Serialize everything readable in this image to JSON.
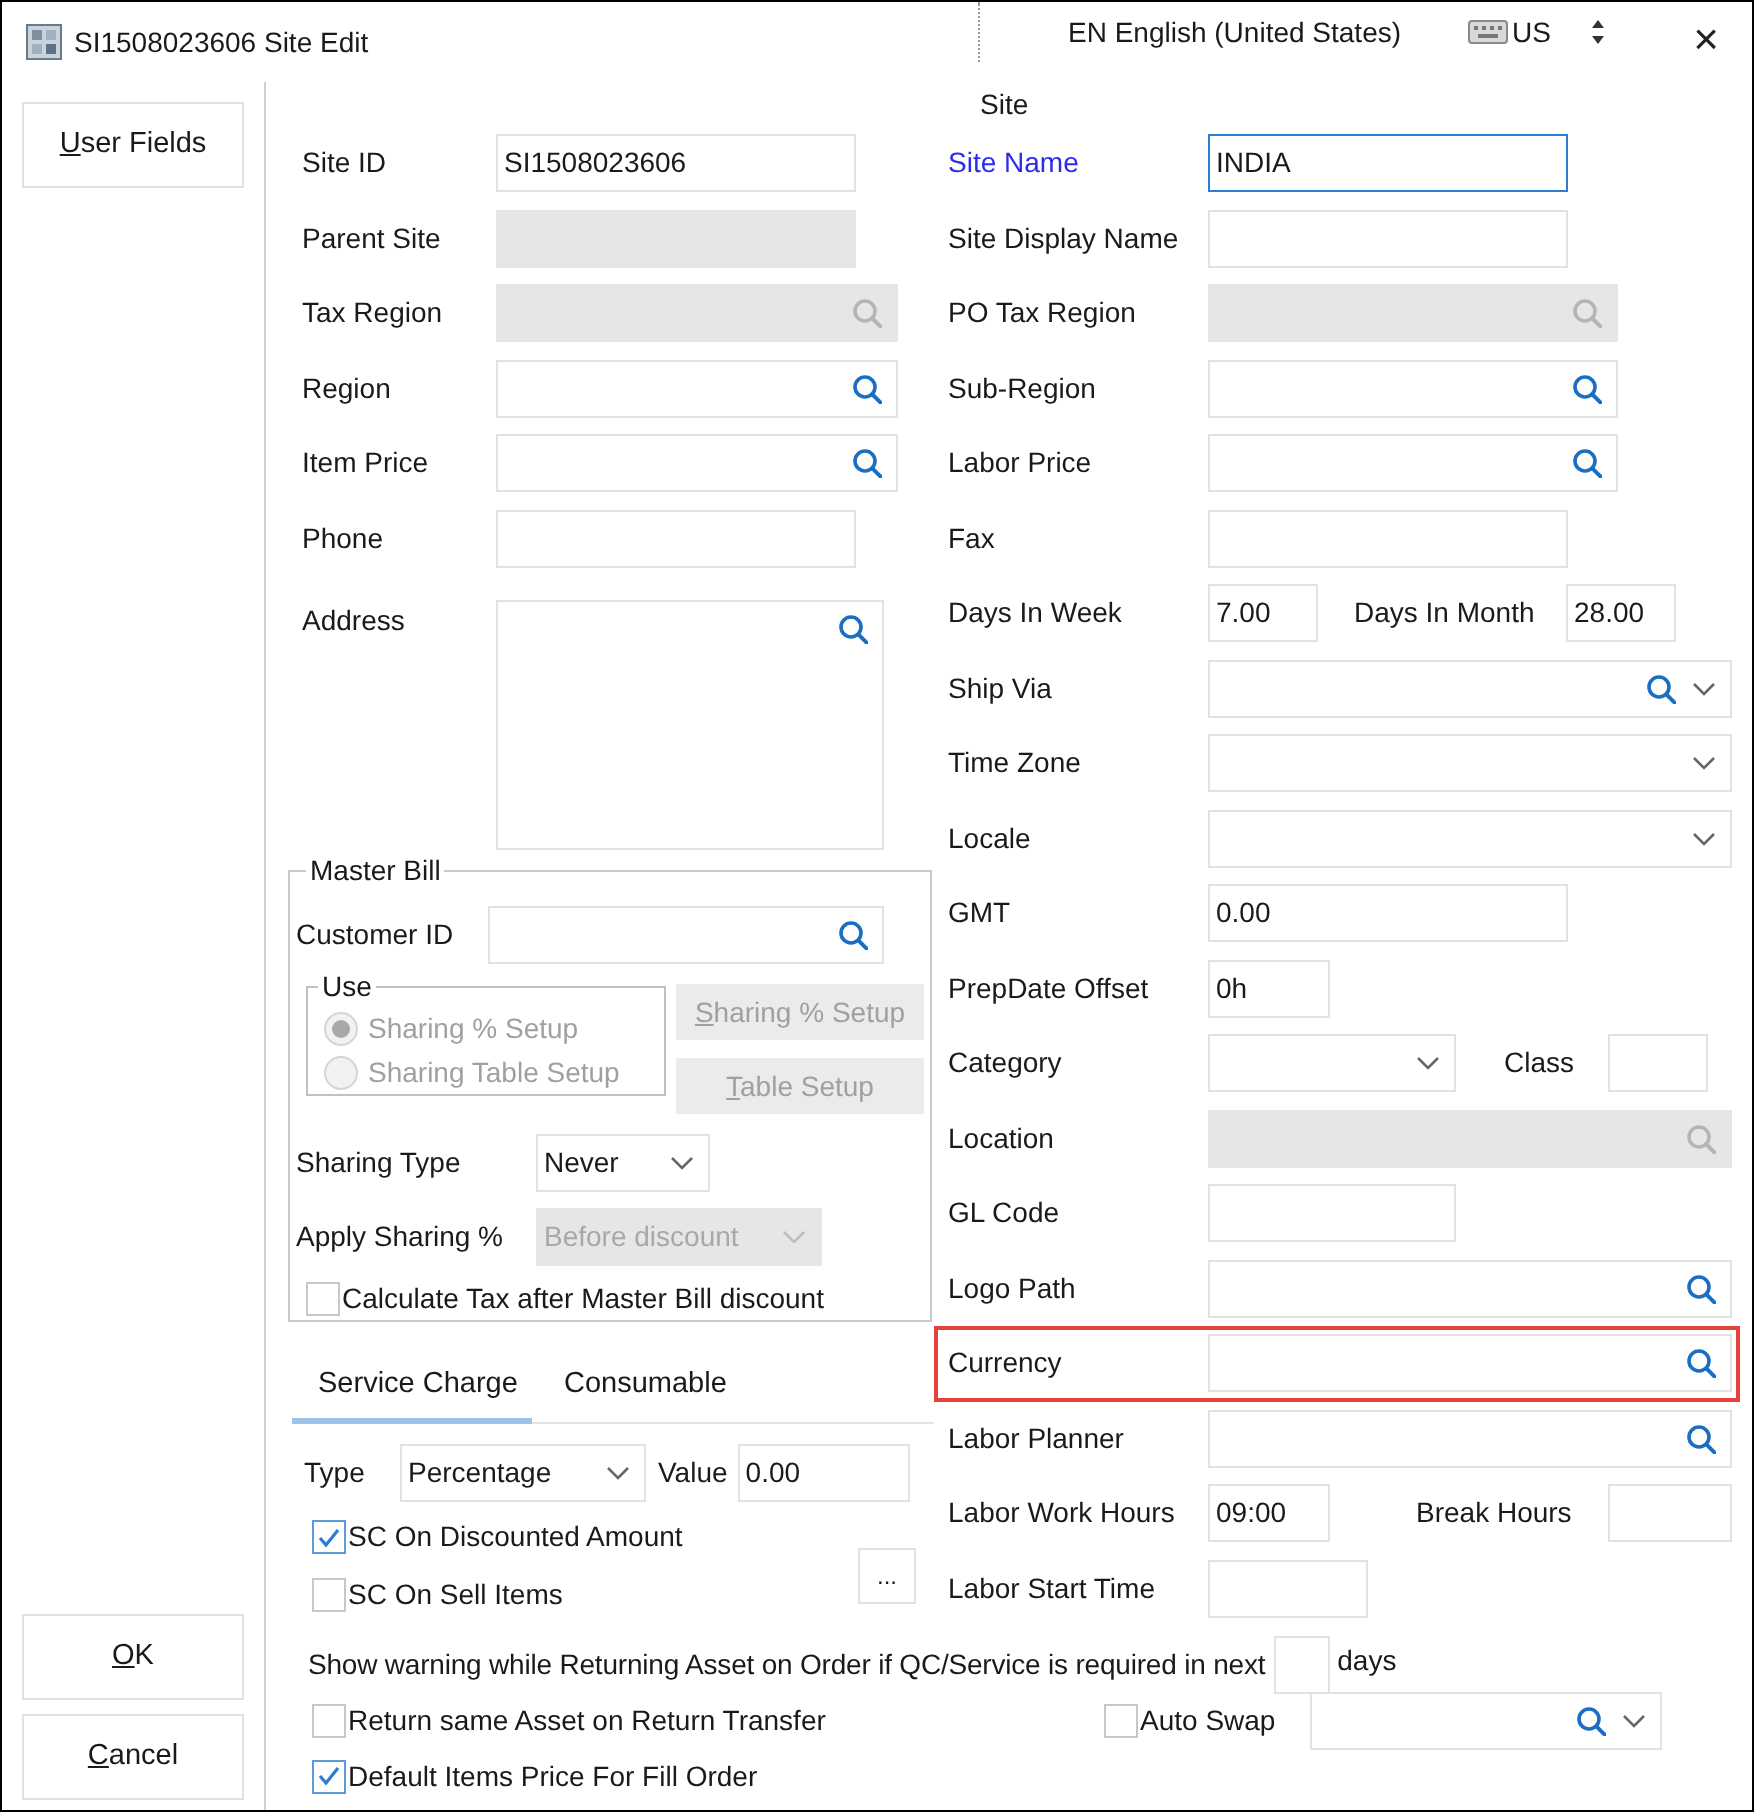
{
  "window": {
    "title": "SI1508023606 Site Edit",
    "close": "×"
  },
  "language_bar": {
    "language": "EN English (United States)",
    "layout": "US"
  },
  "sidebar": {
    "buttons": [
      {
        "label": "User Fields"
      }
    ],
    "footer_buttons": [
      {
        "label": "OK"
      },
      {
        "label": "Cancel"
      }
    ]
  },
  "section_title": "Site",
  "left_fields": [
    {
      "label": "Site ID",
      "kind": "text",
      "value": "SI1508023606",
      "disabled": false
    },
    {
      "label": "Parent Site",
      "kind": "text",
      "disabled": true
    },
    {
      "label": "Tax Region",
      "kind": "search",
      "disabled": true
    },
    {
      "label": "Region",
      "kind": "search",
      "disabled": false
    },
    {
      "label": "Item Price",
      "kind": "search",
      "disabled": false
    },
    {
      "label": "Phone",
      "kind": "text",
      "disabled": false
    },
    {
      "label": "Address",
      "kind": "textarea",
      "disabled": false
    }
  ],
  "right_fields": [
    {
      "label": "Site Name",
      "kind": "text",
      "value": "INDIA",
      "required": true,
      "focused": true,
      "disabled": false,
      "highlighted": false
    },
    {
      "label": "Site Display Name",
      "kind": "text",
      "required": false,
      "focused": false,
      "disabled": false,
      "highlighted": false
    },
    {
      "label": "PO Tax Region",
      "kind": "search",
      "required": false,
      "focused": false,
      "disabled": true,
      "highlighted": false
    },
    {
      "label": "Sub-Region",
      "kind": "search",
      "required": false,
      "focused": false,
      "disabled": false,
      "highlighted": false
    },
    {
      "label": "Labor Price",
      "kind": "search",
      "required": false,
      "focused": false,
      "disabled": false,
      "highlighted": false
    },
    {
      "label": "Fax",
      "kind": "text",
      "required": false,
      "focused": false,
      "disabled": false,
      "highlighted": false
    },
    {
      "label": "Days In Week",
      "kind": "pair",
      "value": "7.00",
      "second_label": "Days In Month",
      "second_value": "28.00",
      "required": false,
      "focused": false,
      "disabled": false,
      "highlighted": false
    },
    {
      "label": "Ship Via",
      "kind": "search_select",
      "required": false,
      "focused": false,
      "disabled": false,
      "highlighted": false
    },
    {
      "label": "Time Zone",
      "kind": "select",
      "required": false,
      "focused": false,
      "disabled": false,
      "highlighted": false
    },
    {
      "label": "Locale",
      "kind": "select",
      "required": false,
      "focused": false,
      "disabled": false,
      "highlighted": false
    },
    {
      "label": "GMT",
      "kind": "text",
      "value": "0.00",
      "required": false,
      "focused": false,
      "disabled": false,
      "highlighted": false
    },
    {
      "label": "PrepDate Offset",
      "kind": "text",
      "value": "0h",
      "required": false,
      "focused": false,
      "disabled": false,
      "highlighted": false
    },
    {
      "label": "Category",
      "kind": "select_pair",
      "second_label": "Class",
      "required": false,
      "focused": false,
      "disabled": false,
      "highlighted": false
    },
    {
      "label": "Location",
      "kind": "search",
      "required": false,
      "focused": false,
      "disabled": true,
      "highlighted": false
    },
    {
      "label": "GL Code",
      "kind": "text",
      "required": false,
      "focused": false,
      "disabled": false,
      "highlighted": false
    },
    {
      "label": "Logo Path",
      "kind": "search",
      "required": false,
      "focused": false,
      "disabled": false,
      "highlighted": false
    },
    {
      "label": "Currency",
      "kind": "search",
      "required": false,
      "focused": false,
      "disabled": false,
      "highlighted": true
    },
    {
      "label": "Labor Planner",
      "kind": "search",
      "required": false,
      "focused": false,
      "disabled": false,
      "highlighted": false
    },
    {
      "label": "Labor Work Hours",
      "kind": "pair",
      "value": "09:00",
      "second_label": "Break Hours",
      "required": false,
      "focused": false,
      "disabled": false,
      "highlighted": false
    },
    {
      "label": "Labor Start Time",
      "kind": "text",
      "required": false,
      "focused": false,
      "disabled": false,
      "highlighted": false
    }
  ],
  "master_bill": {
    "title": "Master Bill",
    "customer_label": "Customer ID",
    "use_group": {
      "title": "Use",
      "options": [
        {
          "label": "Sharing % Setup",
          "selected": true,
          "disabled": true
        },
        {
          "label": "Sharing Table Setup",
          "selected": false,
          "disabled": true
        }
      ]
    },
    "buttons": [
      {
        "label": "Sharing % Setup",
        "disabled": true
      },
      {
        "label": "Table Setup",
        "disabled": true
      }
    ],
    "sharing_type": {
      "label": "Sharing Type",
      "value": "Never",
      "disabled": false
    },
    "apply_sharing": {
      "label": "Apply Sharing %",
      "value": "Before discount",
      "disabled": true
    },
    "calc_tax": {
      "label": "Calculate Tax after Master Bill discount",
      "checked": false
    }
  },
  "tabs": [
    {
      "label": "Service Charge",
      "selected": true
    },
    {
      "label": "Consumable",
      "selected": false
    }
  ],
  "service_charge": {
    "type_label": "Type",
    "type_value": "Percentage",
    "value_label": "Value",
    "value": "0.00",
    "checkboxes": [
      {
        "label": "SC On Discounted Amount",
        "checked": true
      },
      {
        "label": "SC On Sell Items",
        "checked": false
      }
    ],
    "more_button": "..."
  },
  "warning": {
    "text": "Show warning while Returning Asset on Order if QC/Service is required in next",
    "unit": "days"
  },
  "bottom_checks": [
    {
      "label": "Return same Asset on Return Transfer",
      "checked": false
    },
    {
      "label": "Auto Swap",
      "checked": false
    },
    {
      "label": "Default Items Price For Fill Order",
      "checked": true
    }
  ]
}
